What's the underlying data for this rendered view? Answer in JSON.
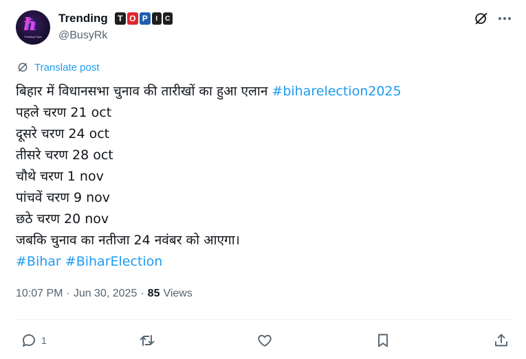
{
  "author": {
    "display_name": "Trending",
    "badge_letters": [
      "T",
      "O",
      "P",
      "I",
      "C"
    ],
    "handle": "@BusyRk",
    "avatar_text": "Trending Topic",
    "verified_badge_colors": [
      "#1f1f1f",
      "#e0262c",
      "#1e5eb0",
      "#1f1f1f",
      "#1f1f1f"
    ]
  },
  "header_icons": [
    "grok-icon",
    "more-icon"
  ],
  "translate": {
    "label": "Translate post",
    "icon": "translate-icon"
  },
  "post": {
    "line1_text": "बिहार में विधानसभा चुनाव की तारीखों का हुआ एलान ",
    "line1_hashtag": "#biharelection2025",
    "lines": [
      "पहले चरण 21 oct",
      "दूसरे चरण 24 oct",
      "तीसरे चरण 28 oct",
      "चौथे चरण 1 nov",
      "पांचवें चरण 9 nov",
      "छठे चरण 20 nov",
      "जबकि चुनाव का नतीजा 24 नवंबर को आएगा।"
    ],
    "hashtags": [
      "#Bihar",
      "#BiharElection"
    ]
  },
  "meta": {
    "time": "10:07 PM",
    "separator": "·",
    "date": "Jun 30, 2025",
    "views_count": "85",
    "views_label": "Views"
  },
  "actions": {
    "reply_count": "1",
    "icons": [
      "reply-icon",
      "repost-icon",
      "like-icon",
      "bookmark-icon",
      "share-icon"
    ]
  },
  "colors": {
    "accent": "#1d9bf0",
    "text": "#0f1419",
    "secondary": "#536471",
    "divider": "#eff3f4"
  }
}
